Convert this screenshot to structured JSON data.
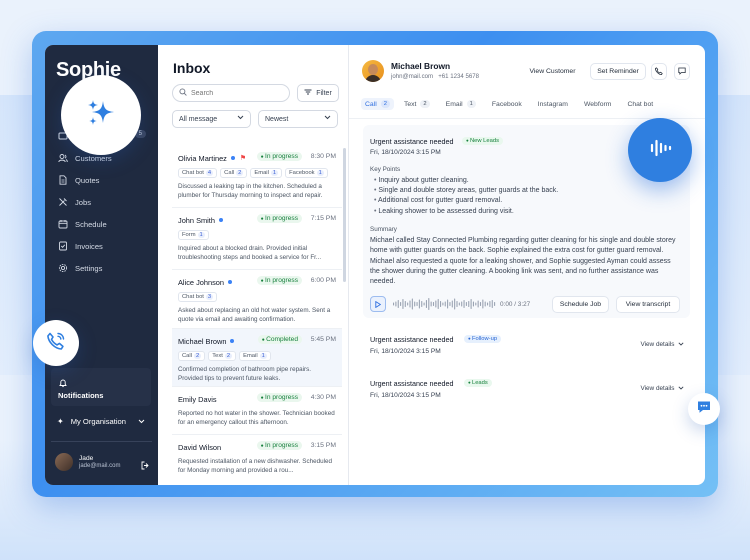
{
  "app": {
    "logo": "Sophie"
  },
  "sidebar": {
    "inbox_count": "5",
    "items": [
      {
        "label": "Customers",
        "icon": "users-icon"
      },
      {
        "label": "Quotes",
        "icon": "document-icon"
      },
      {
        "label": "Jobs",
        "icon": "tools-icon"
      },
      {
        "label": "Schedule",
        "icon": "calendar-icon"
      },
      {
        "label": "Invoices",
        "icon": "invoice-icon"
      },
      {
        "label": "Settings",
        "icon": "gear-icon"
      }
    ],
    "notifications_label": "Notifications",
    "organisation_label": "My Organisation",
    "user": {
      "name": "Jade",
      "email": "jade@mail.com"
    }
  },
  "inbox": {
    "title": "Inbox",
    "search_placeholder": "Search",
    "filter_label": "Filter",
    "message_filter": "All message",
    "sort": "Newest",
    "items": [
      {
        "name": "Olivia Martinez",
        "status": "In progress",
        "time": "8:30 PM",
        "chips": [
          {
            "label": "Chat bot",
            "n": "4"
          },
          {
            "label": "Call",
            "n": "2"
          },
          {
            "label": "Email",
            "n": "1"
          },
          {
            "label": "Facebook",
            "n": "1"
          }
        ],
        "preview": "Discussed a leaking tap in the kitchen. Scheduled a plumber for Thursday morning to inspect and repair."
      },
      {
        "name": "John Smith",
        "status": "In progress",
        "time": "7:15 PM",
        "chips": [
          {
            "label": "Form",
            "n": "1"
          }
        ],
        "preview": "Inquired about a blocked drain. Provided initial troubleshooting steps and booked a service for Fr..."
      },
      {
        "name": "Alice Johnson",
        "status": "In progress",
        "time": "6:00 PM",
        "chips": [
          {
            "label": "Chat bot",
            "n": "3"
          }
        ],
        "preview": "Asked about replacing an old hot water system. Sent a quote via email and awaiting confirmation."
      },
      {
        "name": "Michael Brown",
        "status": "Completed",
        "time": "5:45 PM",
        "chips": [
          {
            "label": "Call",
            "n": "2"
          },
          {
            "label": "Text",
            "n": "2"
          },
          {
            "label": "Email",
            "n": "1"
          }
        ],
        "preview": "Confirmed completion of bathroom pipe repairs. Provided tips to prevent future leaks."
      },
      {
        "name": "Emily Davis",
        "status": "In progress",
        "time": "4:30 PM",
        "chips": [],
        "preview": "Reported no hot water in the shower. Technician booked for an emergency callout this afternoon."
      },
      {
        "name": "David Wilson",
        "status": "In progress",
        "time": "3:15 PM",
        "chips": [],
        "preview": "Requested installation of a new dishwasher. Scheduled for Monday morning and provided a rou..."
      }
    ]
  },
  "contact": {
    "name": "Michael Brown",
    "email": "john@mail.com",
    "phone": "+61 1234 5678",
    "view_customer": "View Customer",
    "set_reminder": "Set Reminder"
  },
  "tabs": [
    {
      "label": "Call",
      "n": "2"
    },
    {
      "label": "Text",
      "n": "2"
    },
    {
      "label": "Email",
      "n": "1"
    },
    {
      "label": "Facebook",
      "n": ""
    },
    {
      "label": "Instagram",
      "n": ""
    },
    {
      "label": "Webform",
      "n": ""
    },
    {
      "label": "Chat bot",
      "n": ""
    }
  ],
  "conversation": {
    "title": "Urgent assistance needed",
    "badge": "New Leads",
    "date": "Fri, 18/10/2024 3:15 PM",
    "key_points_title": "Key Points",
    "key_points": [
      "Inquiry about gutter cleaning.",
      "Single and double storey areas, gutter guards at the back.",
      "Additional cost for gutter guard removal.",
      "Leaking shower to be assessed during visit."
    ],
    "summary_title": "Summary",
    "summary": "Michael called Stay Connected Plumbing regarding gutter cleaning for his single and double storey home with gutter guards on the back. Sophie explained the extra cost for gutter guard removal. Michael also requested a quote for a leaking shower, and Sophie suggested Ayman could assess the shower during the gutter cleaning. A booking link was sent, and no further assistance was needed.",
    "audio_time": "0:00 / 3:27",
    "schedule_job": "Schedule Job",
    "view_transcript": "View transcript"
  },
  "other_conversations": [
    {
      "title": "Urgent assistance needed",
      "badge": "Follow-up",
      "date": "Fri, 18/10/2024 3:15 PM",
      "action": "View details"
    },
    {
      "title": "Urgent assistance needed",
      "badge": "Leads",
      "date": "Fri, 18/10/2024 3:15 PM",
      "action": "View details"
    }
  ]
}
